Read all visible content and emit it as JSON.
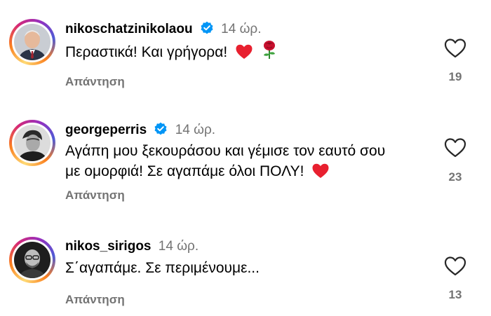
{
  "comments": [
    {
      "username": "nikoschatzinikolaou",
      "verified": true,
      "time": "14 ώρ.",
      "text": "Περαστικά! Και γρήγορα!",
      "emojis": [
        "red-heart",
        "rose"
      ],
      "reply_label": "Απάντηση",
      "likes": "19"
    },
    {
      "username": "georgeperris",
      "verified": true,
      "time": "14 ώρ.",
      "text_line1": "Αγάπη μου ξεκουράσου και γέμισε τον εαυτό σου",
      "text_line2": "με ομορφιά! Σε αγαπάμε όλοι ΠΟΛΥ!",
      "emojis": [
        "red-heart"
      ],
      "reply_label": "Απάντηση",
      "likes": "23"
    },
    {
      "username": "nikos_sirigos",
      "verified": false,
      "time": "14 ώρ.",
      "text": "Σ΄αγαπάμε. Σε περιμένουμε...",
      "emojis": [],
      "reply_label": "Απάντηση",
      "likes": "13"
    }
  ],
  "colors": {
    "verified_blue": "#0095f6",
    "secondary_text": "#737373",
    "heart_red": "#e0245e"
  },
  "icons": {
    "like": "heart-outline-icon",
    "verified": "verified-badge-icon"
  }
}
